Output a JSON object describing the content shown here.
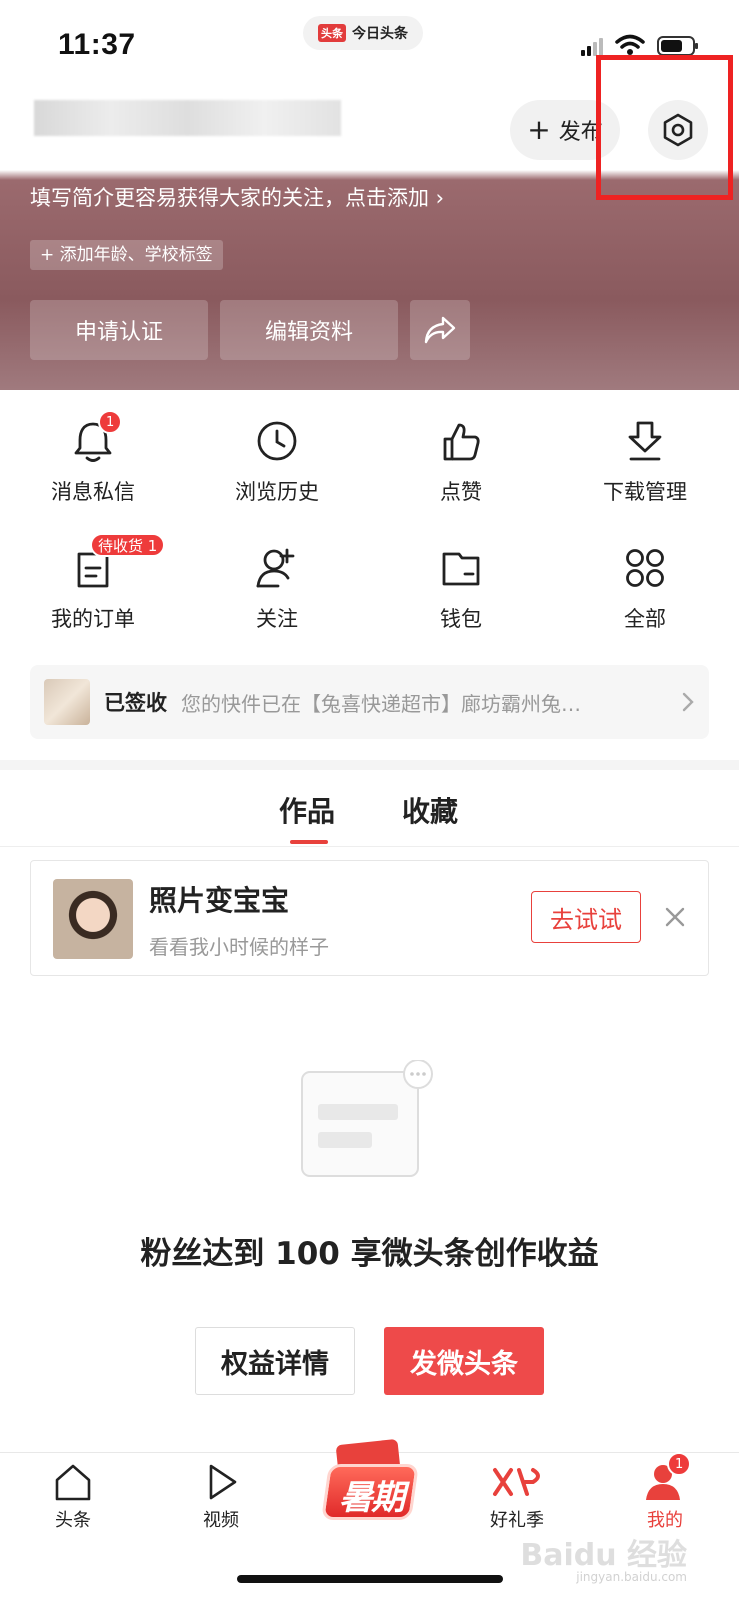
{
  "status_bar": {
    "time": "11:37",
    "app_logo": "头条",
    "app_name": "今日头条"
  },
  "header": {
    "publish_label": "发布",
    "bio_prompt": "填写简介更容易获得大家的关注，点击添加 ›",
    "tag_prompt": "+ 添加年龄、学校标签",
    "verify_label": "申请认证",
    "edit_label": "编辑资料"
  },
  "grid": [
    {
      "label": "消息私信",
      "icon": "bell-icon",
      "badge": "1"
    },
    {
      "label": "浏览历史",
      "icon": "clock-icon",
      "badge": ""
    },
    {
      "label": "点赞",
      "icon": "thumbs-up-icon",
      "badge": ""
    },
    {
      "label": "下载管理",
      "icon": "download-icon",
      "badge": ""
    },
    {
      "label": "我的订单",
      "icon": "order-icon",
      "badge": "待收货 1"
    },
    {
      "label": "关注",
      "icon": "add-user-icon",
      "badge": ""
    },
    {
      "label": "钱包",
      "icon": "wallet-icon",
      "badge": ""
    },
    {
      "label": "全部",
      "icon": "grid-icon",
      "badge": ""
    }
  ],
  "delivery": {
    "status": "已签收",
    "text": "您的快件已在【兔喜快递超市】廊坊霸州兔…"
  },
  "tabs": [
    "作品",
    "收藏"
  ],
  "promo": {
    "title": "照片变宝宝",
    "subtitle": "看看我小时候的样子",
    "button": "去试试"
  },
  "empty_state": {
    "message": "粉丝达到 100 享微头条创作收益",
    "rights_button": "权益详情",
    "post_button": "发微头条"
  },
  "bottom_nav": [
    {
      "label": "头条",
      "icon": "home-icon"
    },
    {
      "label": "视频",
      "icon": "play-icon"
    },
    {
      "label": "暑期",
      "icon": "summer-logo"
    },
    {
      "label": "好礼季",
      "icon": "gift-season-icon"
    },
    {
      "label": "我的",
      "icon": "profile-icon",
      "badge": "1"
    }
  ],
  "watermark": {
    "main": "Baidu 经验",
    "sub": "jingyan.baidu.com"
  },
  "colors": {
    "accent": "#e8413c",
    "highlight_box": "#ee2222"
  }
}
